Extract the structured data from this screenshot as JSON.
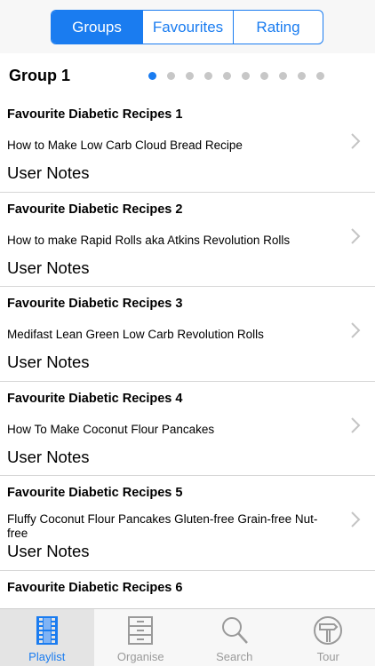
{
  "segmented": {
    "items": [
      "Groups",
      "Favourites",
      "Rating"
    ],
    "active_index": 0
  },
  "group": {
    "title": "Group 1",
    "page_count": 10,
    "current_page": 1
  },
  "list": {
    "rows": [
      {
        "title": "Favourite Diabetic Recipes 1",
        "subtitle": "How to  Make  Low Carb Cloud Bread  Recipe",
        "notes": "User Notes"
      },
      {
        "title": "Favourite Diabetic Recipes 2",
        "subtitle": "How to make Rapid Rolls aka Atkins Revolution Rolls",
        "notes": "User Notes"
      },
      {
        "title": "Favourite Diabetic Recipes 3",
        "subtitle": "Medifast Lean  Green Low Carb Revolution Rolls",
        "notes": "User Notes"
      },
      {
        "title": "Favourite Diabetic Recipes 4",
        "subtitle": "How To Make Coconut Flour Pancakes",
        "notes": "User Notes"
      },
      {
        "title": "Favourite Diabetic Recipes 5",
        "subtitle": "Fluffy Coconut Flour Pancakes Gluten-free Grain-free Nut-free",
        "notes": "User Notes"
      },
      {
        "title": "Favourite Diabetic Recipes 6",
        "subtitle": "",
        "notes": ""
      }
    ]
  },
  "tabbar": {
    "tabs": [
      {
        "label": "Playlist",
        "icon": "film-strip-icon"
      },
      {
        "label": "Organise",
        "icon": "cabinet-icon"
      },
      {
        "label": "Search",
        "icon": "magnifier-icon"
      },
      {
        "label": "Tour",
        "icon": "signpost-icon"
      }
    ],
    "active_index": 0
  },
  "colors": {
    "accent": "#1a7cf0",
    "tab_inactive": "#9a9a9a",
    "separator": "#d6d6d6"
  }
}
